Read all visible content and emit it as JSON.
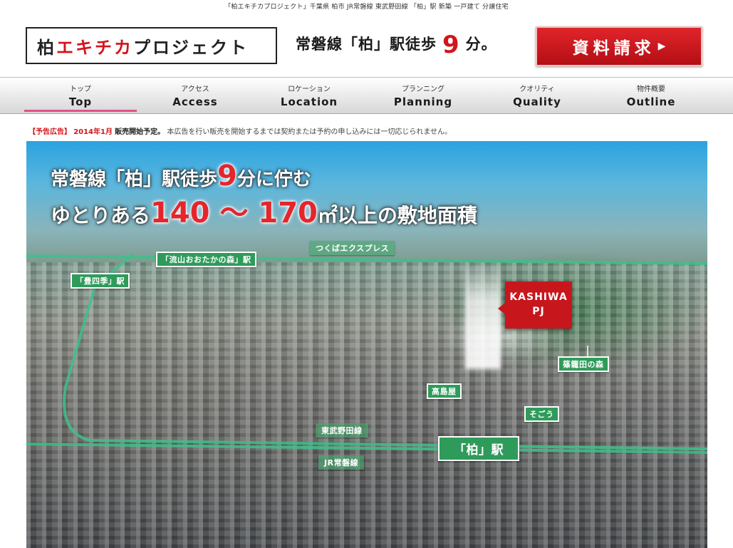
{
  "top_caption": "「柏エキチカプロジェクト」千葉県 柏市 JR常磐線 東武野田線 「柏」駅 新築 一戸建て 分譲住宅",
  "logo": {
    "part1": "柏",
    "part2": "エキチカ",
    "part3": "プロジェクト"
  },
  "tagline": {
    "prefix": "常磐線「柏」駅徒歩",
    "minutes": "9",
    "suffix": "分。"
  },
  "cta": {
    "label": "資料請求",
    "arrow": "▶"
  },
  "nav": [
    {
      "jp": "トップ",
      "en": "Top"
    },
    {
      "jp": "アクセス",
      "en": "Access"
    },
    {
      "jp": "ロケーション",
      "en": "Location"
    },
    {
      "jp": "プランニング",
      "en": "Planning"
    },
    {
      "jp": "クオリティ",
      "en": "Quality"
    },
    {
      "jp": "物件概要",
      "en": "Outline"
    }
  ],
  "notice": {
    "tag": "【予告広告】",
    "date": "2014年1月",
    "status": "販売開始予定。",
    "text": "本広告を行い販売を開始するまでは契約または予約の申し込みには一切応じられません。"
  },
  "hero": {
    "line1_a": "常磐線「柏」駅徒歩",
    "line1_num": "9",
    "line1_b": "分に佇む",
    "line2_a": "ゆとりある",
    "line2_num": "140 〜 170",
    "line2_b": "㎡以上の敷地面積"
  },
  "map_labels": {
    "tsukuba": "つくばエクスプレス",
    "nagareyama": "「流山おおたかの森」駅",
    "toyoshiki": "「豊四季」駅",
    "pj_line1": "KASHIWA",
    "pj_line2": "PJ",
    "shinoda": "篠籠田の森",
    "takashimaya": "高島屋",
    "sogo": "そごう",
    "tobu": "東武野田線",
    "kashiwa_station": "「柏」駅",
    "jr": "JR常磐線"
  },
  "colors": {
    "accent_red": "#d3141b",
    "rail_green": "#2f9b5b",
    "nav_active": "#e2528a"
  }
}
